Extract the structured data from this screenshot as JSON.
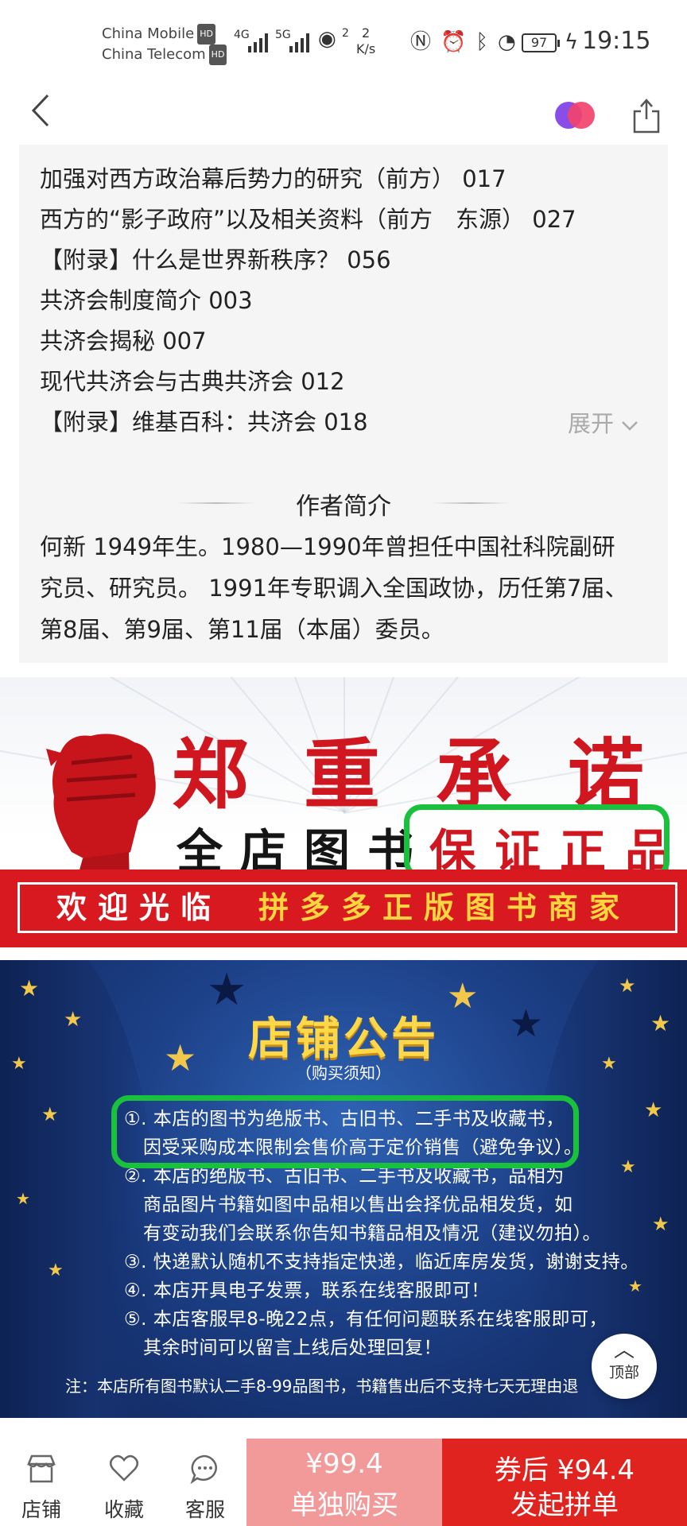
{
  "status_bar": {
    "carrier1": "China Mobile",
    "carrier2": "China Telecom",
    "hd": "HD",
    "net1": "4G",
    "net2": "5G",
    "wifi_sup": "2",
    "speed_value": "2",
    "speed_unit": "K/s",
    "battery": "97",
    "time": "19:15"
  },
  "nav": {
    "back_icon": "chevron-left-icon",
    "share_icon": "share-icon"
  },
  "toc": {
    "lines": [
      "加强对西方政治幕后势力的研究（前方） 017",
      "西方的“影子政府”以及相关资料（前方　东源） 027",
      "【附录】什么是世界新秩序？ 056",
      "共济会制度简介 003",
      "共济会揭秘 007",
      "现代共济会与古典共济会 012",
      "【附录】维基百科：共济会 018"
    ],
    "expand_label": "展开"
  },
  "author": {
    "heading": "作者简介",
    "lines": [
      "何新 1949年生。1980—1990年曾担任中国社科院副研",
      "究员、研究员。 1991年专职调入全国政协，历任第7届、",
      "第8届、第9届、第11届（本届）委员。"
    ]
  },
  "promise_banner": {
    "title": "郑重承诺",
    "subtitle": "全店图书",
    "guarantee": "保证正品",
    "welcome": "欢迎光临",
    "merchant": "拼多多正版图书商家",
    "accent_color": "#d0161e",
    "highlight_color": "#19c13c"
  },
  "notice_banner": {
    "title": "店铺公告",
    "subtitle": "（购买须知）",
    "lines": [
      "①. 本店的图书为绝版书、古旧书、二手书及收藏书，",
      "因受采购成本限制会售价高于定价销售（避免争议）。",
      "②. 本店的绝版书、古旧书、二手书及收藏书，品相为",
      "商品图片书籍如图中品相以售出会择优品相发货，如",
      "有变动我们会联系你告知书籍品相及情况（建议勿拍）。",
      "③. 快递默认随机不支持指定快递，临近库房发货，谢谢支持。",
      "④. 本店开具电子发票，联系在线客服即可！",
      "⑤. 本店客服早8-晚22点，有任何问题联系在线客服即可，",
      "其余时间可以留言上线后处理回复！"
    ],
    "footer": "注：本店所有图书默认二手8-99品图书，书籍售出后不支持七天无理由退"
  },
  "back_to_top": {
    "label": "顶部"
  },
  "bottom_bar": {
    "tabs": [
      {
        "label": "店铺",
        "icon": "store-icon"
      },
      {
        "label": "收藏",
        "icon": "heart-icon"
      },
      {
        "label": "客服",
        "icon": "chat-icon"
      }
    ],
    "single_price": "¥99.4",
    "single_action": "单独购买",
    "group_price": "券后 ¥94.4",
    "group_action": "发起拼单",
    "single_color": "#f29a9a",
    "group_color": "#e0231f"
  }
}
